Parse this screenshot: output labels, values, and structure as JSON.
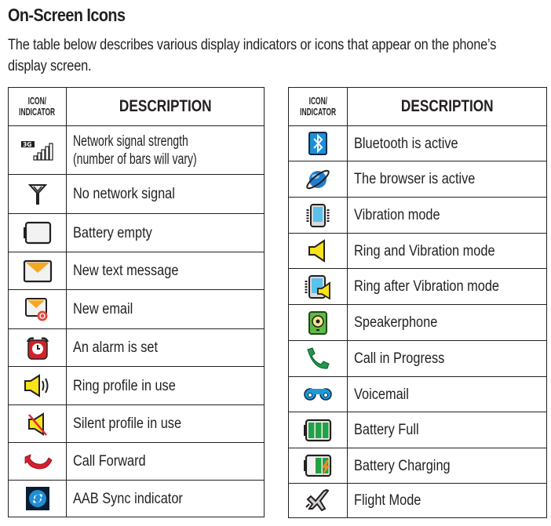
{
  "title": "On-Screen Icons",
  "intro": "The table below describes various display indicators or icons that appear on the phone’s display screen.",
  "headers": {
    "icon_line1": "ICON/",
    "icon_line2": "INDICATOR",
    "description": "DESCRIPTION"
  },
  "left_table": [
    {
      "icon": "network-signal-icon",
      "description_line1": "Network signal strength",
      "description_line2": "(number of bars will vary)"
    },
    {
      "icon": "no-signal-icon",
      "description": "No network signal"
    },
    {
      "icon": "battery-empty-icon",
      "description": "Battery empty"
    },
    {
      "icon": "text-message-icon",
      "description": "New text message"
    },
    {
      "icon": "email-icon",
      "description": "New email"
    },
    {
      "icon": "alarm-icon",
      "description": "An alarm is set"
    },
    {
      "icon": "ring-profile-icon",
      "description": "Ring profile in use"
    },
    {
      "icon": "silent-profile-icon",
      "description": "Silent profile in use"
    },
    {
      "icon": "call-forward-icon",
      "description": "Call Forward"
    },
    {
      "icon": "aab-sync-icon",
      "description": "AAB Sync indicator"
    }
  ],
  "right_table": [
    {
      "icon": "bluetooth-icon",
      "description": "Bluetooth is active"
    },
    {
      "icon": "browser-icon",
      "description": "The browser is active"
    },
    {
      "icon": "vibration-icon",
      "description": "Vibration mode"
    },
    {
      "icon": "ring-vibration-icon",
      "description": "Ring and Vibration mode"
    },
    {
      "icon": "ring-after-vibration-icon",
      "description": "Ring after Vibration mode"
    },
    {
      "icon": "speakerphone-icon",
      "description": "Speakerphone"
    },
    {
      "icon": "call-in-progress-icon",
      "description": "Call in Progress"
    },
    {
      "icon": "voicemail-icon",
      "description": "Voicemail"
    },
    {
      "icon": "battery-full-icon",
      "description": "Battery Full"
    },
    {
      "icon": "battery-charging-icon",
      "description": "Battery Charging"
    },
    {
      "icon": "flight-mode-icon",
      "description": "Flight Mode"
    }
  ]
}
